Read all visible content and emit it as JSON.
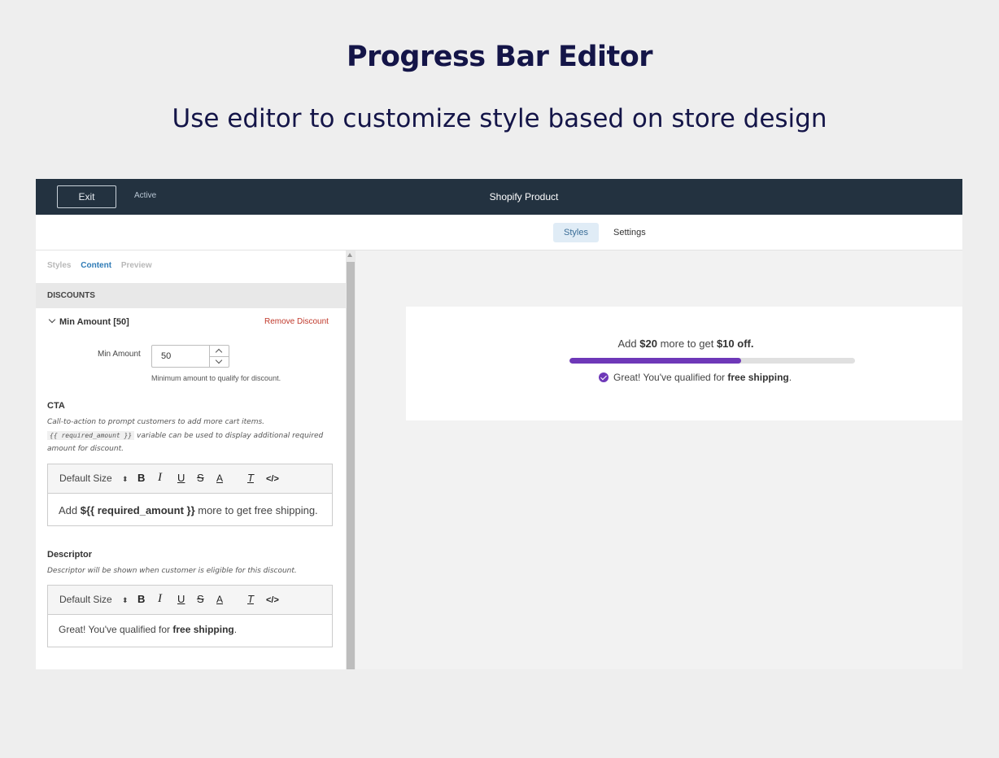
{
  "hero": {
    "title": "Progress Bar Editor",
    "subtitle": "Use editor to customize style based on store design"
  },
  "topbar": {
    "exit_label": "Exit",
    "status": "Active",
    "title": "Shopify Product"
  },
  "main_tabs": [
    "Styles",
    "Settings"
  ],
  "sidebar": {
    "tabs": [
      "Styles",
      "Content",
      "Preview"
    ],
    "active_tab": "Content",
    "section_title": "DISCOUNTS",
    "discount": {
      "title": "Min Amount [50]",
      "remove_label": "Remove Discount",
      "min_amount_label": "Min Amount",
      "min_amount_value": "50",
      "min_amount_help": "Minimum amount to qualify for discount."
    },
    "cta": {
      "title": "CTA",
      "desc_1": "Call-to-action to prompt customers to add more cart items.",
      "variable": "{{ required_amount }}",
      "desc_2": "variable can be used to display additional required amount for discount.",
      "toolbar_size": "Default Size",
      "content_prefix": "Add ",
      "content_bold": "${{ required_amount }}",
      "content_suffix": " more to get free shipping."
    },
    "descriptor": {
      "title": "Descriptor",
      "desc": "Descriptor will be shown when customer is eligible for this discount.",
      "toolbar_size": "Default Size",
      "content_prefix": "Great! You've qualified for ",
      "content_bold": "free shipping",
      "content_suffix": "."
    },
    "toolbar_glyphs": {
      "arrows": "⬍",
      "bold": "B",
      "italic": "I",
      "underline": "U",
      "strike": "S",
      "color": "A",
      "clear": "T",
      "code": "</>"
    }
  },
  "preview": {
    "cta_prefix": "Add ",
    "cta_amount": "$20",
    "cta_middle": " more to get ",
    "cta_reward": "$10 off.",
    "progress_fraction": 0.6,
    "bar_color": "#6e38b8",
    "qualified_prefix": "Great! You've qualified for ",
    "qualified_bold": "free shipping",
    "qualified_suffix": "."
  },
  "colors": {
    "hero_text": "#141548",
    "topbar_bg": "#233240",
    "accent_blue": "#2e7bb6",
    "remove_red": "#c0392b",
    "progress_purple": "#6e38b8"
  }
}
